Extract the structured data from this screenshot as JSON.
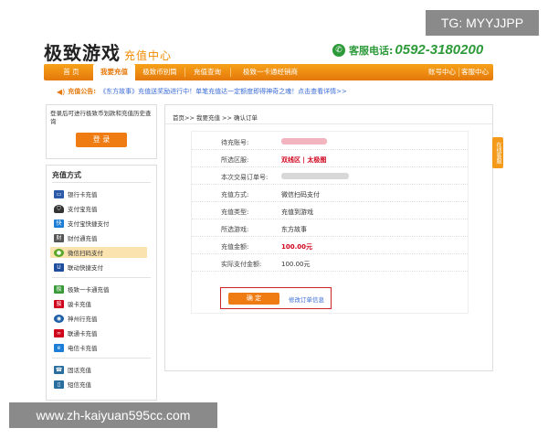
{
  "watermark_top": "TG: MYYJJPP",
  "watermark_bottom": "www.zh-kaiyuan595cc.com",
  "header": {
    "logo": "极致游戏",
    "logo_sub": "充值中心",
    "hotline_label": "客服电话:",
    "hotline_number": "0592-3180200"
  },
  "nav": {
    "items": [
      "首 页",
      "我要充值",
      "极致币别筒",
      "充值查询",
      "极致一卡通经销商"
    ],
    "right_items": [
      "账号中心",
      "客服中心"
    ],
    "active_index": 1
  },
  "notice": {
    "title": "充值公告:",
    "text": "《东方故事》充值送奖励进行中！单笔充值达一定额度即得神奇之魂！点击查看详情>>"
  },
  "login": {
    "hint": "登录后可进行极致币划款和充值历史查询",
    "button": "登 录"
  },
  "methods": {
    "title": "充值方式",
    "group1": [
      "银行卡充值",
      "支付宝充值",
      "支付宝快捷支付",
      "财付通充值",
      "微信扫码支付",
      "联动快捷支付"
    ],
    "group2": [
      "极致一卡通充值",
      "骏卡充值",
      "神州行充值",
      "联通卡充值",
      "电信卡充值"
    ],
    "group3": [
      "固话充值",
      "短信充值"
    ],
    "selected": "微信扫码支付"
  },
  "breadcrumb": "首页>> 我要充值 >> 确认订单",
  "order": {
    "rows": [
      {
        "label": "待充账号:",
        "value": "",
        "masked": true,
        "mask_color": "pink"
      },
      {
        "label": "所选区服:",
        "value": "双线区 | 太极图",
        "emphasis": true
      },
      {
        "label": "本次交易订单号:",
        "value": "",
        "masked": true,
        "mask_color": "gray"
      },
      {
        "label": "充值方式:",
        "value": "微信扫码支付"
      },
      {
        "label": "充值类型:",
        "value": "充值到游戏"
      },
      {
        "label": "所选游戏:",
        "value": "东方故事"
      },
      {
        "label": "充值金额:",
        "value": "100.00元",
        "emphasis": true
      },
      {
        "label": "实际支付金额:",
        "value": "100.00元"
      }
    ]
  },
  "confirm": {
    "button": "确 定",
    "link": "修改订单信息"
  },
  "side_tab": "在线客服",
  "colors": {
    "accent": "#ef7c12",
    "nav": "#e5780a",
    "green": "#2d9a3a",
    "red": "#d0021b",
    "link": "#3a6bd6"
  }
}
